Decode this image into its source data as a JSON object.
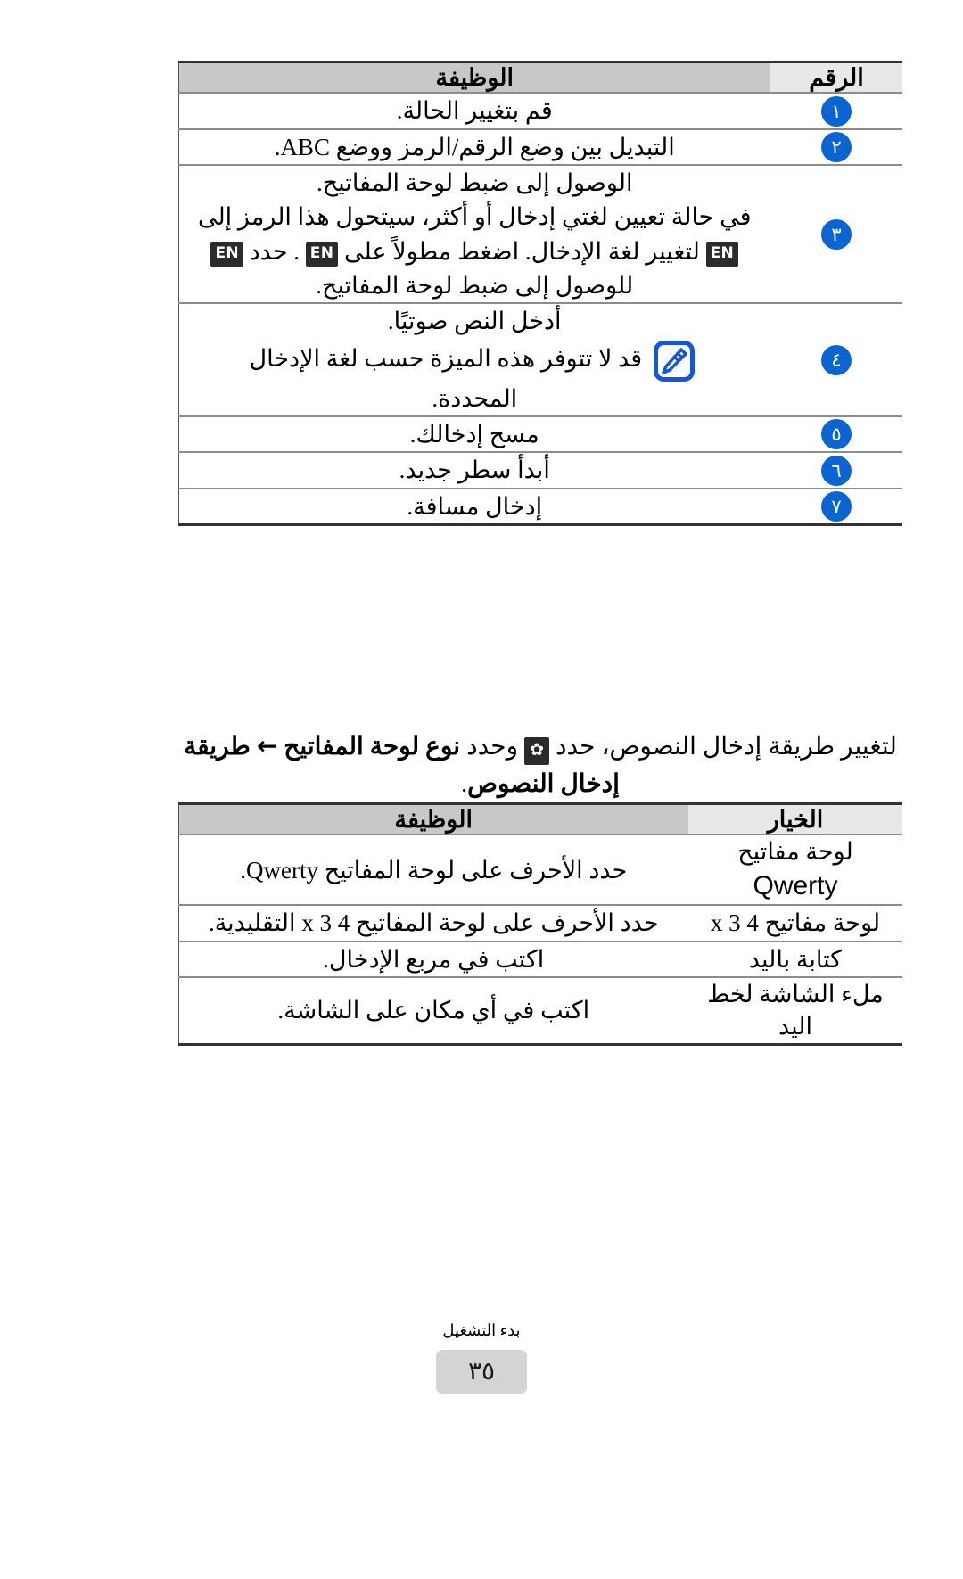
{
  "document": {
    "language": "ar",
    "direction": "rtl"
  },
  "table_one": {
    "name": "keypad-functions-table",
    "headers": {
      "number": "الرقم",
      "function": "الوظيفة"
    },
    "rows": [
      {
        "number": "١",
        "function": "قم بتغيير الحالة."
      },
      {
        "number": "٢",
        "function": "التبديل بين وضع الرقم/الرمز ووضع ABC."
      },
      {
        "number": "٣",
        "function_line1": "الوصول إلى ضبط لوحة المفاتيح.",
        "function_line2_a": "في حالة تعيين لغتي إدخال أو أكثر، سيتحول هذا الرمز إلى",
        "function_badge_1": "EN",
        "function_line2_b": ". حدد",
        "function_badge_2": "EN",
        "function_line2_c": "لتغيير لغة الإدخال. اضغط مطولاً على",
        "function_badge_3": "EN",
        "function_line3": "للوصول إلى ضبط لوحة المفاتيح."
      },
      {
        "number": "٤",
        "function_line1": "أدخل النص صوتيًا.",
        "note_icon": "note-pencil-icon",
        "note_line1": "قد لا تتوفر هذه الميزة حسب لغة الإدخال",
        "note_line2": "المحددة."
      },
      {
        "number": "٥",
        "function": "مسح إدخالك."
      },
      {
        "number": "٦",
        "function": "أبدأ سطر جديد."
      },
      {
        "number": "٧",
        "function": "إدخال مسافة."
      }
    ]
  },
  "paragraph": {
    "name": "text-input-method-instruction",
    "part1": "لتغيير طريقة إدخال النصوص، حدد",
    "gear_icon": "gear-icon",
    "gear_glyph": "✿",
    "part2": "وحدد",
    "bold1": "نوع لوحة المفاتيح",
    "arrow": "←",
    "bold2": "طريقة إدخال النصوص",
    "trailing": "."
  },
  "table_two": {
    "name": "keyboard-type-options-table",
    "headers": {
      "option": "الخيار",
      "function": "الوظيفة"
    },
    "rows": [
      {
        "option_line1": "لوحة مفاتيح",
        "option_line2": "Qwerty",
        "function": "حدد الأحرف على لوحة المفاتيح Qwerty."
      },
      {
        "option_line1": "لوحة مفاتيح 4 x 3",
        "option_line2": "",
        "function": "حدد الأحرف على لوحة المفاتيح 4 x 3 التقليدية."
      },
      {
        "option_line1": "كتابة باليد",
        "option_line2": "",
        "function": "اكتب في مربع الإدخال."
      },
      {
        "option_line1": "ملء الشاشة لخط",
        "option_line2": "اليد",
        "function": "اكتب في أي مكان على الشاشة."
      }
    ]
  },
  "footer": {
    "section_title": "بدء التشغيل",
    "page_number": "٣٥"
  }
}
